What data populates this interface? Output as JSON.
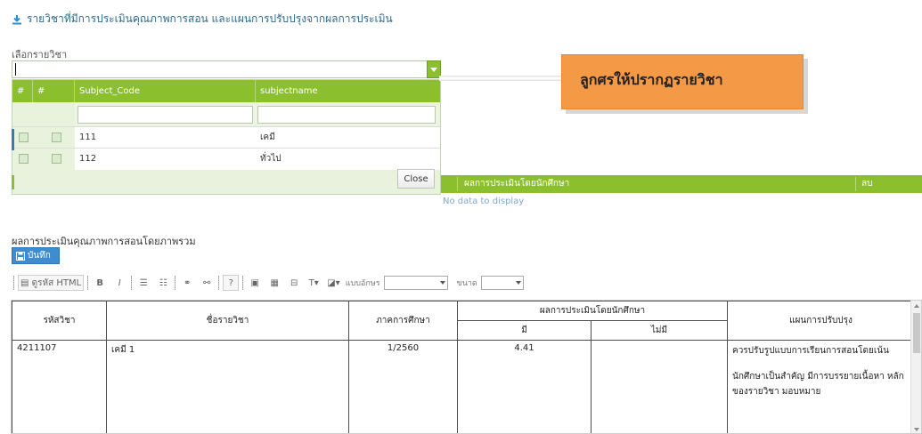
{
  "page_title": "รายวิชาที่มีการประเมินคุณภาพการสอน และแผนการปรับปรุงจากผลการประเมิน",
  "subject_select": {
    "label": "เลือกรายวิชา",
    "value": "",
    "columns": [
      "#",
      "#",
      "Subject_Code",
      "subjectname"
    ],
    "rows": [
      {
        "code": "111",
        "name": "เคมี"
      },
      {
        "code": "112",
        "name": "ทั่วไป"
      }
    ],
    "close_label": "Close"
  },
  "callout_text": "ลูกศรให้ปรากฏรายวิชา",
  "result_grid": {
    "header_evaluation": "ผลการประเมินโดยนักศึกษา",
    "header_delete": "ลบ",
    "empty_text": "No data to display"
  },
  "overall_section": {
    "title": "ผลการประเมินคุณภาพการสอนโดยภาพรวม",
    "save_label": "บันทึก"
  },
  "editor_toolbar": {
    "source_label": "ดูรหัส HTML",
    "font_label": "แบบอักษร",
    "size_label": "ขนาด",
    "font_value": "",
    "size_value": ""
  },
  "doc_table": {
    "headers": {
      "code": "รหัสวิชา",
      "name": "ชื่อรายวิชา",
      "term": "ภาคการศึกษา",
      "evaluation": "ผลการประเมินโดยนักศึกษา",
      "has": "มี",
      "none": "ไม่มี",
      "plan": "แผนการปรับปรุง"
    },
    "row": {
      "code": "4211107",
      "name": "เคมี 1",
      "term": "1/2560",
      "has": "4.41",
      "none": "",
      "plan_1": "ควรปรับรูปแบบการเรียนการสอนโดยเน้น",
      "plan_2": "นักศึกษาเป็นสำคัญ มีการบรรยายเนื้อหา หลักของรายวิชา มอบหมาย"
    }
  },
  "colors": {
    "grid_green": "#8bbf2e",
    "callout_orange": "#f49a46",
    "save_blue": "#3e8ccf",
    "title_blue": "#2e6b8a"
  }
}
